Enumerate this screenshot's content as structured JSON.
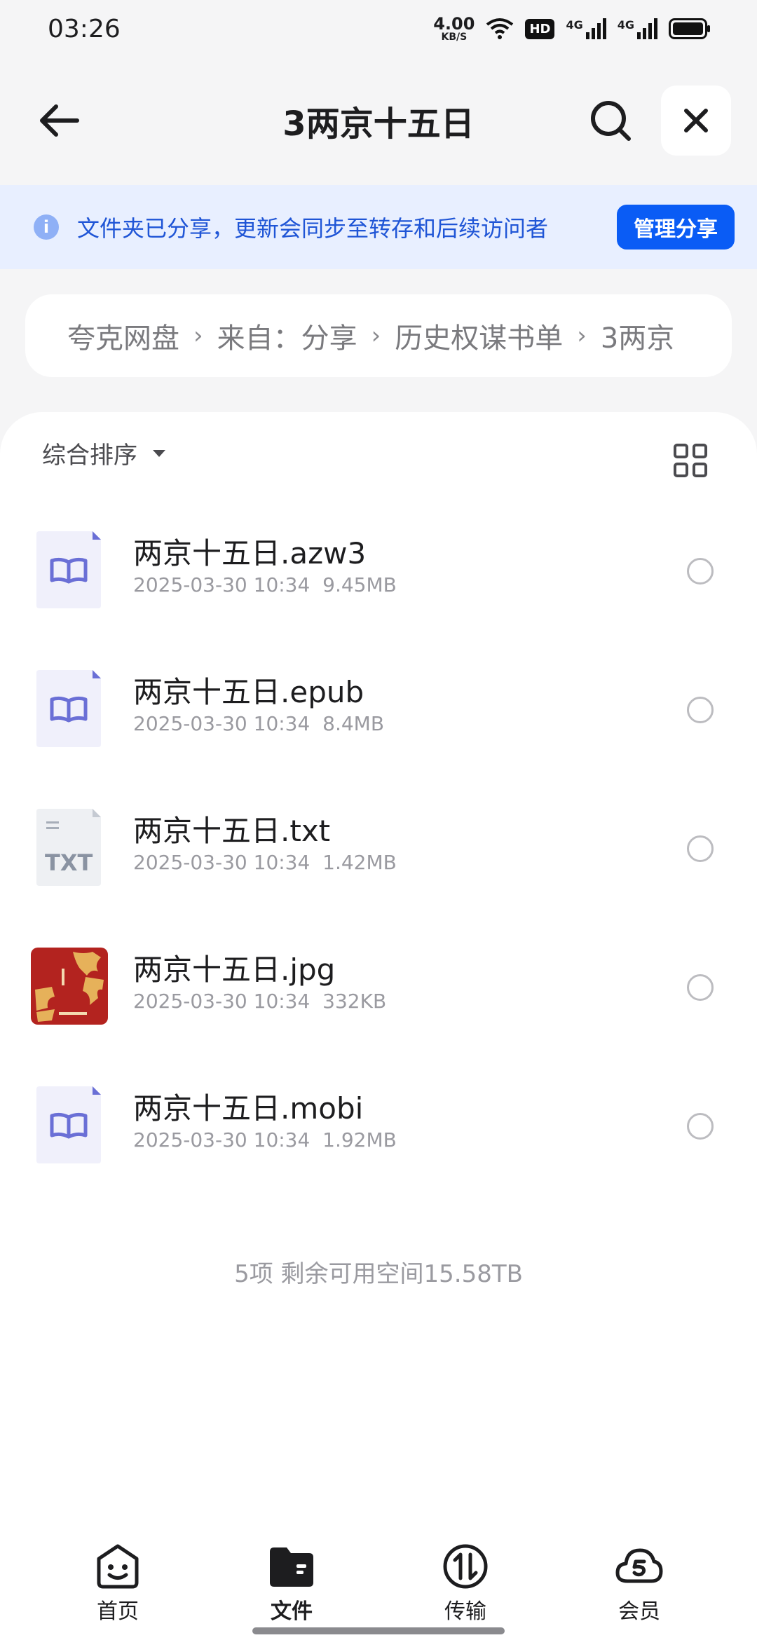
{
  "status_bar": {
    "time": "03:26",
    "speed_value": "4.00",
    "speed_unit": "KB/S",
    "hd_badge": "HD",
    "network_1": "4G",
    "network_2": "4G"
  },
  "header": {
    "title": "3两京十五日",
    "icons": [
      "back-arrow-icon",
      "search-icon",
      "close-icon"
    ]
  },
  "banner": {
    "text": "文件夹已分享，更新会同步至转存和后续访问者",
    "button_label": "管理分享",
    "info_glyph": "i"
  },
  "breadcrumb": {
    "items": [
      "夸克网盘",
      "来自：分享",
      "历史权谋书单",
      "3两京"
    ]
  },
  "sort": {
    "label": "综合排序"
  },
  "files": [
    {
      "name": "两京十五日.azw3",
      "date": "2025-03-30 10:34",
      "size": "9.45MB",
      "icon": "ebook-file-icon"
    },
    {
      "name": "两京十五日.epub",
      "date": "2025-03-30 10:34",
      "size": "8.4MB",
      "icon": "ebook-file-icon"
    },
    {
      "name": "两京十五日.txt",
      "date": "2025-03-30 10:34",
      "size": "1.42MB",
      "icon": "txt-file-icon",
      "icon_label": "TXT"
    },
    {
      "name": "两京十五日.jpg",
      "date": "2025-03-30 10:34",
      "size": "332KB",
      "icon": "image-thumbnail"
    },
    {
      "name": "两京十五日.mobi",
      "date": "2025-03-30 10:34",
      "size": "1.92MB",
      "icon": "ebook-file-icon"
    }
  ],
  "summary": "5项 剩余可用空间15.58TB",
  "nav": {
    "home": "首页",
    "files": "文件",
    "transfer": "传输",
    "member": "会员"
  },
  "colors": {
    "accent": "#0a5cf5",
    "banner_bg": "#e8efff",
    "banner_text": "#1f55d6",
    "ebook_icon": "#6a6fd6"
  }
}
